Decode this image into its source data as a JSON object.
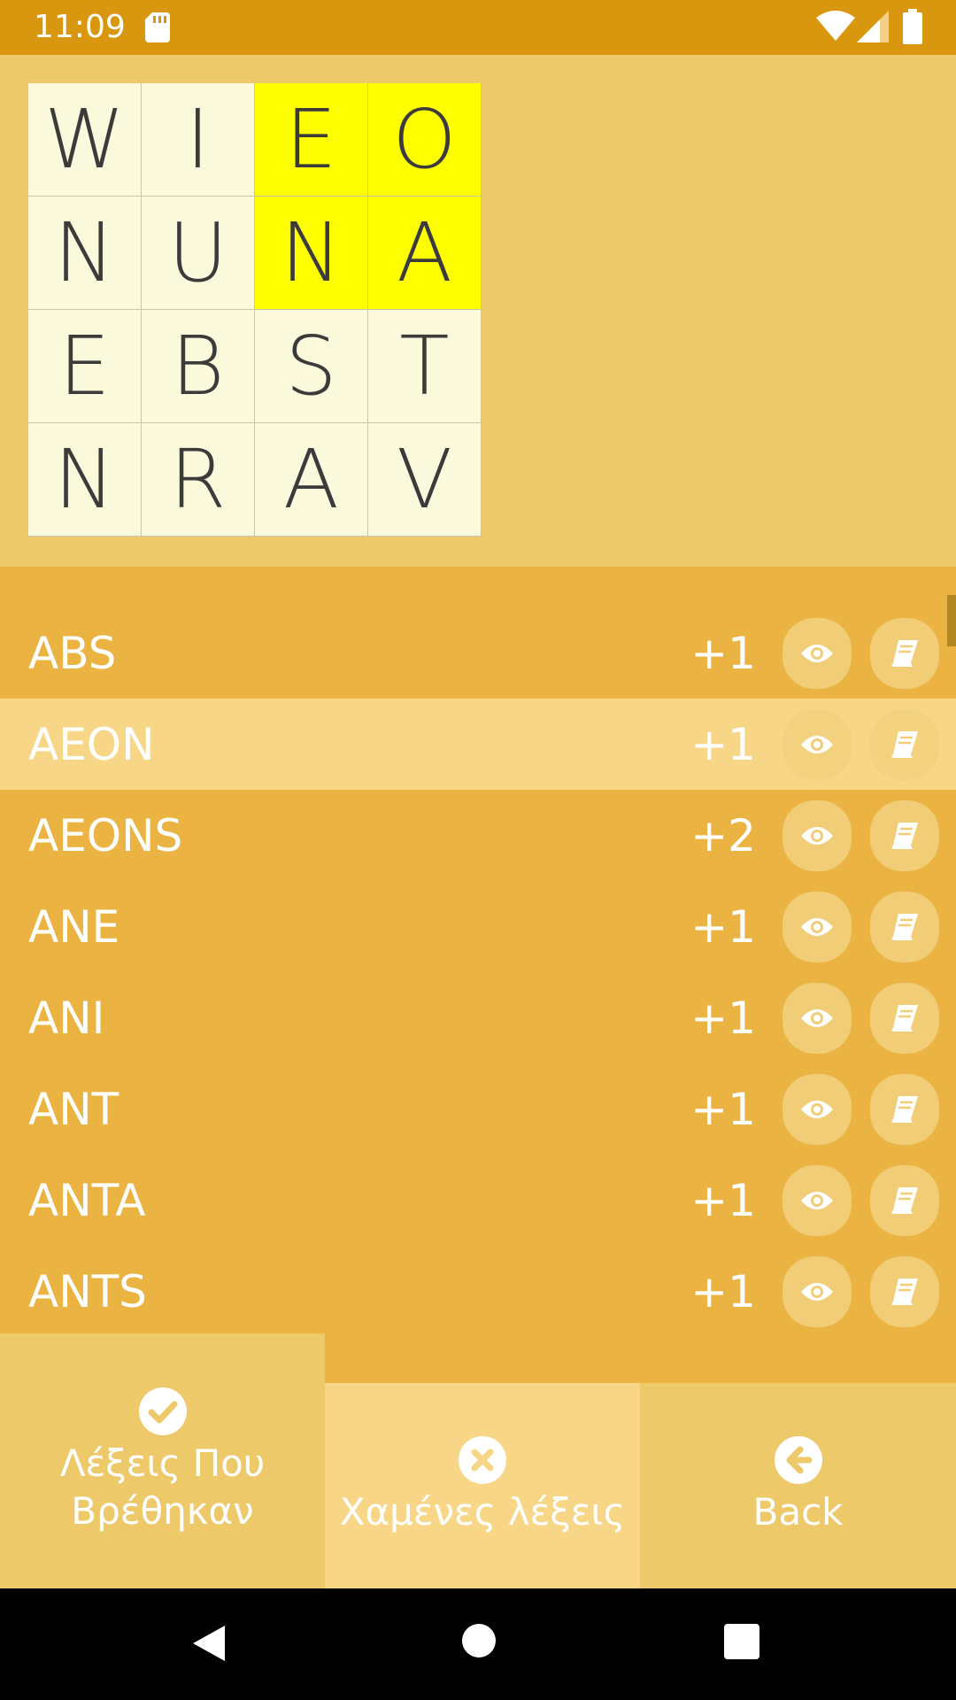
{
  "status_bar": {
    "time": "11:09"
  },
  "board": {
    "rows": [
      [
        "W",
        "I",
        "E",
        "O"
      ],
      [
        "N",
        "U",
        "N",
        "A"
      ],
      [
        "E",
        "B",
        "S",
        "T"
      ],
      [
        "N",
        "R",
        "A",
        "V"
      ]
    ],
    "highlight_color": "#FFFF00",
    "highlighted": [
      "0-2",
      "0-3",
      "1-2",
      "1-3"
    ]
  },
  "words": [
    {
      "word": "ABS",
      "score": "+1"
    },
    {
      "word": "AEON",
      "score": "+1",
      "selected": true
    },
    {
      "word": "AEONS",
      "score": "+2"
    },
    {
      "word": "ANE",
      "score": "+1"
    },
    {
      "word": "ANI",
      "score": "+1"
    },
    {
      "word": "ANT",
      "score": "+1"
    },
    {
      "word": "ANTA",
      "score": "+1"
    },
    {
      "word": "ANTS",
      "score": "+1"
    }
  ],
  "row_icons": {
    "reveal": "eye-icon",
    "dictionary": "book-icon"
  },
  "tabs": {
    "found": {
      "line1": "Λέξεις Που",
      "line2": "Βρέθηκαν",
      "icon": "check-circle-icon"
    },
    "missed": {
      "label": "Χαμένες λέξεις",
      "icon": "x-circle-icon"
    },
    "back": {
      "label": "Back",
      "icon": "arrow-left-circle-icon"
    }
  },
  "colors": {
    "status_bar": "#D9960F",
    "board_bg": "#EDC96A",
    "list_bg": "#EBB442",
    "selected_row": "#F7D787"
  }
}
